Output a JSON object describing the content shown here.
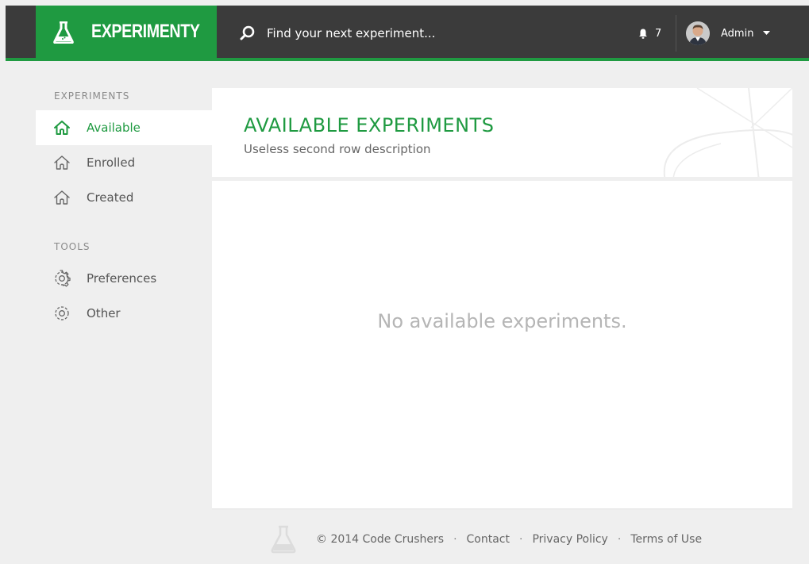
{
  "header": {
    "brand": "EXPERIMENTY",
    "search_placeholder": "Find your next experiment...",
    "notification_count": "7",
    "user_name": "Admin"
  },
  "sidebar": {
    "sections": [
      {
        "title": "EXPERIMENTS",
        "items": [
          {
            "label": "Available",
            "icon": "home-icon",
            "active": true
          },
          {
            "label": "Enrolled",
            "icon": "home-icon",
            "active": false
          },
          {
            "label": "Created",
            "icon": "home-icon",
            "active": false
          }
        ]
      },
      {
        "title": "TOOLS",
        "items": [
          {
            "label": "Preferences",
            "icon": "gear-icon",
            "active": false
          },
          {
            "label": "Other",
            "icon": "gear-icon",
            "active": false
          }
        ]
      }
    ]
  },
  "main": {
    "title": "AVAILABLE EXPERIMENTS",
    "subtitle": "Useless second row description",
    "empty_message": "No available experiments."
  },
  "footer": {
    "copyright": "© 2014 Code Crushers",
    "separator": "·",
    "links": [
      "Contact",
      "Privacy Policy",
      "Terms of Use"
    ]
  },
  "colors": {
    "accent": "#1f9a41",
    "topbar": "#3b3b3b",
    "background": "#efefef"
  }
}
